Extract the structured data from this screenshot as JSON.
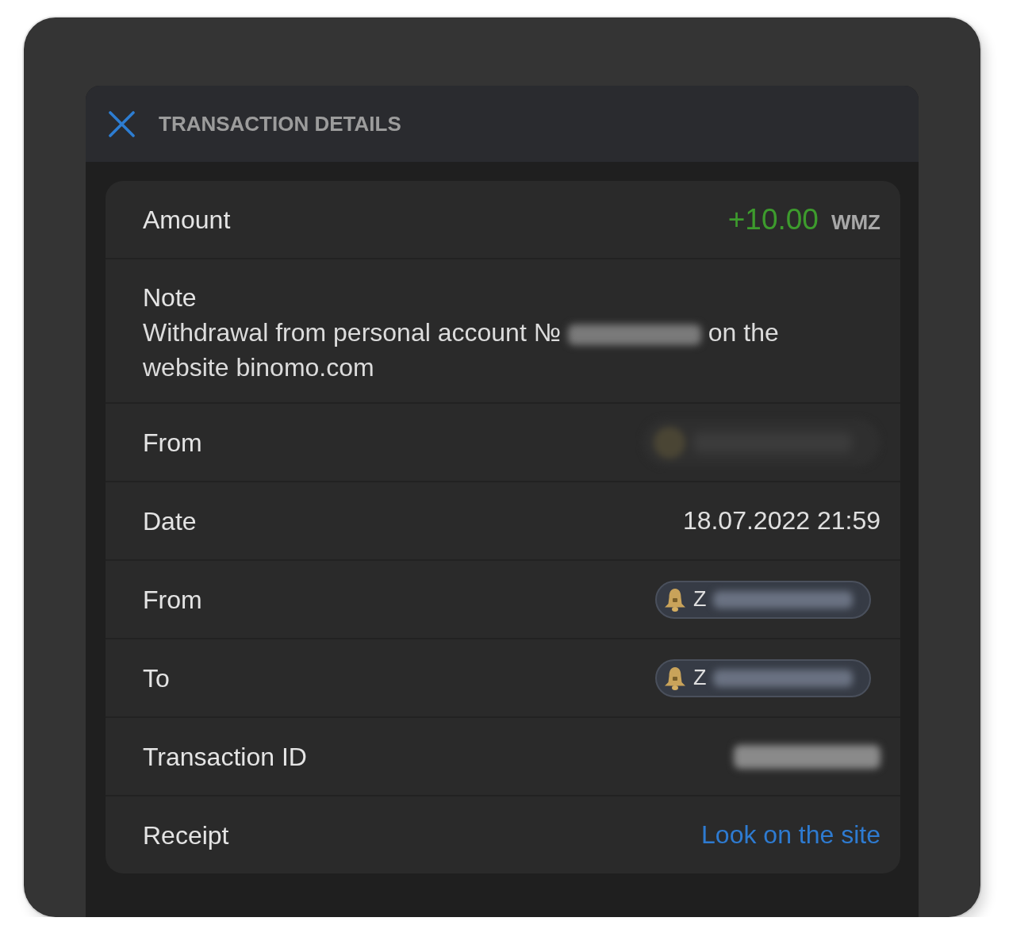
{
  "dialog": {
    "title": "TRANSACTION DETAILS"
  },
  "rows": [
    {
      "kind": "amount",
      "label": "Amount",
      "value": "+10.00",
      "currency": "WMZ"
    },
    {
      "kind": "note",
      "label": "Note",
      "text_before": "Withdrawal from personal account №",
      "text_after": "on the website binomo.com"
    },
    {
      "kind": "hidden_badge",
      "label": "From"
    },
    {
      "kind": "text",
      "label": "Date",
      "value": "18.07.2022 21:59"
    },
    {
      "kind": "wallet",
      "label": "From",
      "prefix": "Z"
    },
    {
      "kind": "wallet",
      "label": "To",
      "prefix": "Z"
    },
    {
      "kind": "hidden",
      "label": "Transaction ID"
    },
    {
      "kind": "link",
      "label": "Receipt",
      "value": "Look on the site"
    }
  ]
}
